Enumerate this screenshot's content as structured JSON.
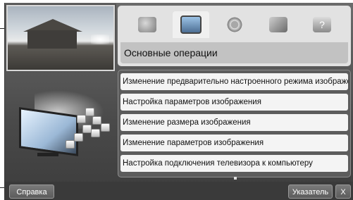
{
  "tabs": [
    {
      "icon": "satellite-dish-icon",
      "active": false
    },
    {
      "icon": "tv-settings-icon",
      "active": true
    },
    {
      "icon": "tools-gear-icon",
      "active": false
    },
    {
      "icon": "network-devices-icon",
      "active": false
    },
    {
      "icon": "help-question-icon",
      "active": false
    }
  ],
  "section_title": "Основные операции",
  "menu_items": [
    "Изменение предварительно настроенного режима изображения",
    "Настройка параметров изображения",
    "Изменение размера изображения",
    "Изменение параметров изображения",
    "Настройка подключения телевизора к компьютеру"
  ],
  "buttons": {
    "help": "Справка",
    "pointer": "Указатель",
    "close": "X"
  }
}
